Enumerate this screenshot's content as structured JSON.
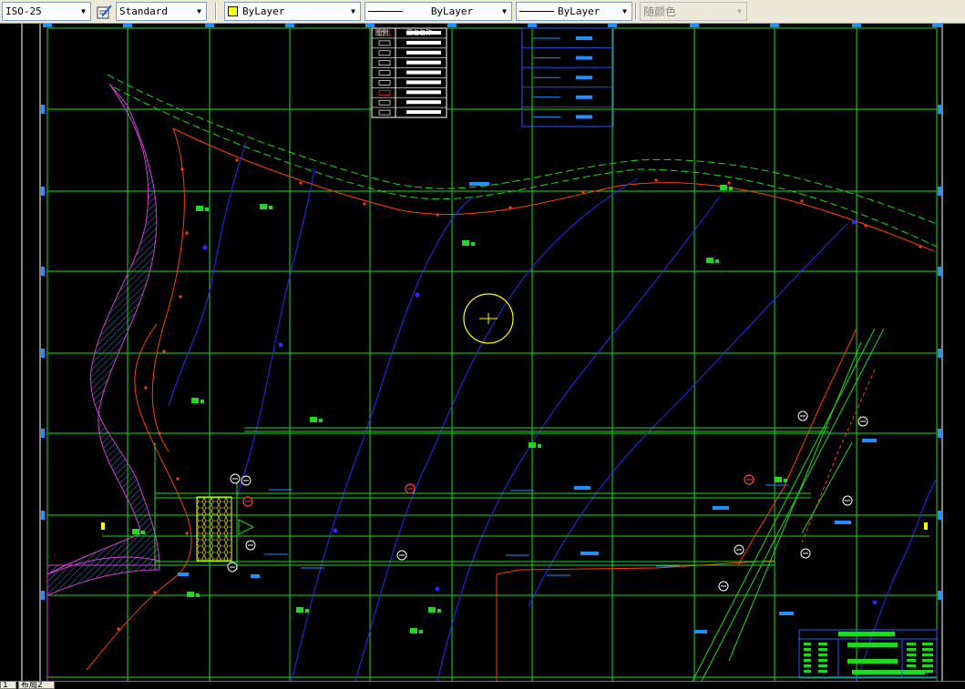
{
  "toolbar": {
    "dimstyle": "ISO-25",
    "textstyle": "Standard",
    "layer_color": "ByLayer",
    "linetype": "ByLayer",
    "lineweight": "ByLayer",
    "plotstyle": "随颜色"
  },
  "tabs": [
    "1",
    "布局2"
  ],
  "legend_table": {
    "rows": [
      "图例",
      "",
      "",
      "工",
      "",
      "",
      "",
      "",
      ""
    ],
    "names": [
      "图名名称",
      "",
      "",
      "",
      "",
      "",
      "",
      "",
      ""
    ],
    "icons": [
      "hatch-icon",
      "pipe-icon",
      "stair-icon",
      "gate-icon",
      "tank-icon",
      "pump-icon",
      "valve-icon",
      "box-icon",
      "tower-icon"
    ]
  },
  "colors": {
    "grid": "#1fd81f",
    "river_edge": "#d33fd3",
    "river_hatch": "#3f7fd8",
    "red_line": "#ff4000",
    "blue_line": "#2a2aff",
    "label_blue": "#1e90ff",
    "yellow": "#ffff00",
    "white": "#ffffff"
  }
}
